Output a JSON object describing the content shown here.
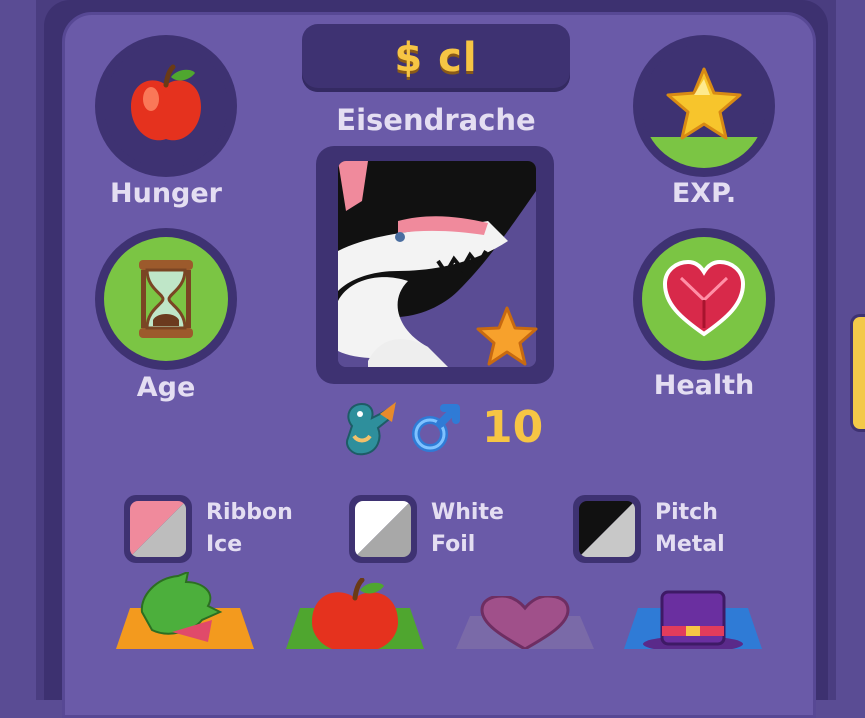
{
  "pet": {
    "name": "$ cl",
    "breed": "Eisendrache",
    "level": "10",
    "gender": "male"
  },
  "stats": {
    "hunger_label": "Hunger",
    "age_label": "Age",
    "exp_label": "EXP.",
    "health_label": "Health",
    "hunger_level": 0.0,
    "age_level": 1.0,
    "exp_level": 0.25,
    "health_level": 1.0
  },
  "genes": [
    {
      "line1": "Ribbon",
      "line2": "Ice",
      "color_a": "#f08a9c",
      "color_b": "#bdbdbd"
    },
    {
      "line1": "White",
      "line2": "Foil",
      "color_a": "#ffffff",
      "color_b": "#a8a8a8"
    },
    {
      "line1": "Pitch",
      "line2": "Metal",
      "color_a": "#111111",
      "color_b": "#c8c8c8"
    }
  ],
  "icons": {
    "hunger": "apple-icon",
    "age": "hourglass-icon",
    "exp": "star-icon",
    "health": "heart-icon",
    "species": "dragon-icon",
    "gender": "male-symbol-icon",
    "favorite": "star-icon"
  },
  "bottom_buttons": [
    "dragon-icon",
    "apple-icon",
    "heart-icon",
    "top-hat-icon"
  ],
  "colors": {
    "accent": "#f6c544",
    "panel": "#6a5aa8",
    "dark": "#3e3272",
    "fill": "#7bc544"
  }
}
